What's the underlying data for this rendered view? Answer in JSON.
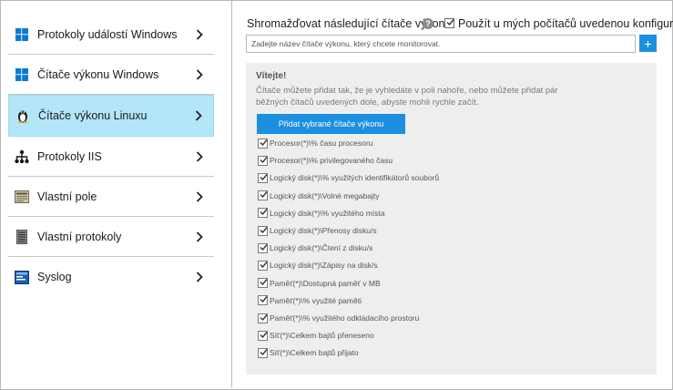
{
  "nav": {
    "items": [
      {
        "label": "Protokoly událostí Windows",
        "icon": "windows-icon"
      },
      {
        "label": "Čítače výkonu Windows",
        "icon": "windows-icon"
      },
      {
        "label": "Čítače výkonu Linuxu",
        "icon": "linux-penguin-icon"
      },
      {
        "label": "Protokoly IIS",
        "icon": "network-tree-icon"
      },
      {
        "label": "Vlastní pole",
        "icon": "custom-field-icon"
      },
      {
        "label": "Vlastní protokoly",
        "icon": "custom-log-icon"
      },
      {
        "label": "Syslog",
        "icon": "syslog-icon"
      }
    ],
    "active_index": 2
  },
  "header": {
    "collect_label": "Shromažďovat následující čítače výkonu",
    "help_glyph": "?",
    "apply_config_label": "Použít u mých počítačů uvedenou konfiguraci",
    "apply_config_checked": true
  },
  "search": {
    "placeholder": "Zadejte název čítače výkonu, který chcete monitorovat.",
    "add_glyph": "+"
  },
  "welcome": {
    "title": "Vítejte!",
    "text": "Čítače můžete přidat tak, že je vyhledáte v poli nahoře, nebo můžete přidat pár běžných čítačů uvedených dole, abyste mohli rychle začít.",
    "add_button": "Přidat vybrané čítače výkonu"
  },
  "counters": [
    {
      "label": "Procesor(*)\\% času procesoru",
      "checked": true
    },
    {
      "label": "Procesor(*)\\% privilegovaného času",
      "checked": true
    },
    {
      "label": "Logický disk(*)\\% využitých identifikátorů souborů",
      "checked": true
    },
    {
      "label": "Logický disk(*)\\Volné megabajty",
      "checked": true
    },
    {
      "label": "Logický disk(*)\\% využitého místa",
      "checked": true
    },
    {
      "label": "Logický disk(*)\\Přenosy disku/s",
      "checked": true
    },
    {
      "label": "Logický disk(*)\\Čtení z disku/s",
      "checked": true
    },
    {
      "label": "Logický disk(*)\\Zápisy na disk/s",
      "checked": true
    },
    {
      "label": "Paměť(*)\\Dostupná paměť v MB",
      "checked": true
    },
    {
      "label": "Paměť(*)\\% využité paměti",
      "checked": true
    },
    {
      "label": "Paměť(*)\\% využitého odkládacího prostoru",
      "checked": true
    },
    {
      "label": "Síť(*)\\Celkem bajtů přeneseno",
      "checked": true
    },
    {
      "label": "Síť(*)\\Celkem bajtů přijato",
      "checked": true
    }
  ],
  "colors": {
    "accent": "#1b8fe0",
    "active_nav": "#b4e6fa",
    "panel_bg": "#eeeeee"
  }
}
